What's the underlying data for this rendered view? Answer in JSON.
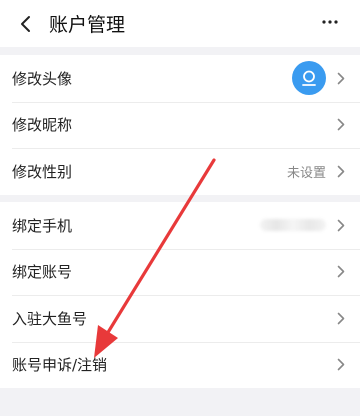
{
  "header": {
    "title": "账户管理"
  },
  "group1": [
    {
      "label": "修改头像"
    },
    {
      "label": "修改昵称"
    },
    {
      "label": "修改性别",
      "value": "未设置"
    }
  ],
  "group2": [
    {
      "label": "绑定手机"
    },
    {
      "label": "绑定账号"
    },
    {
      "label": "入驻大鱼号"
    },
    {
      "label": "账号申诉/注销"
    }
  ],
  "colors": {
    "avatar_bg": "#3a9bf0",
    "annotation_arrow": "#e8393a"
  }
}
